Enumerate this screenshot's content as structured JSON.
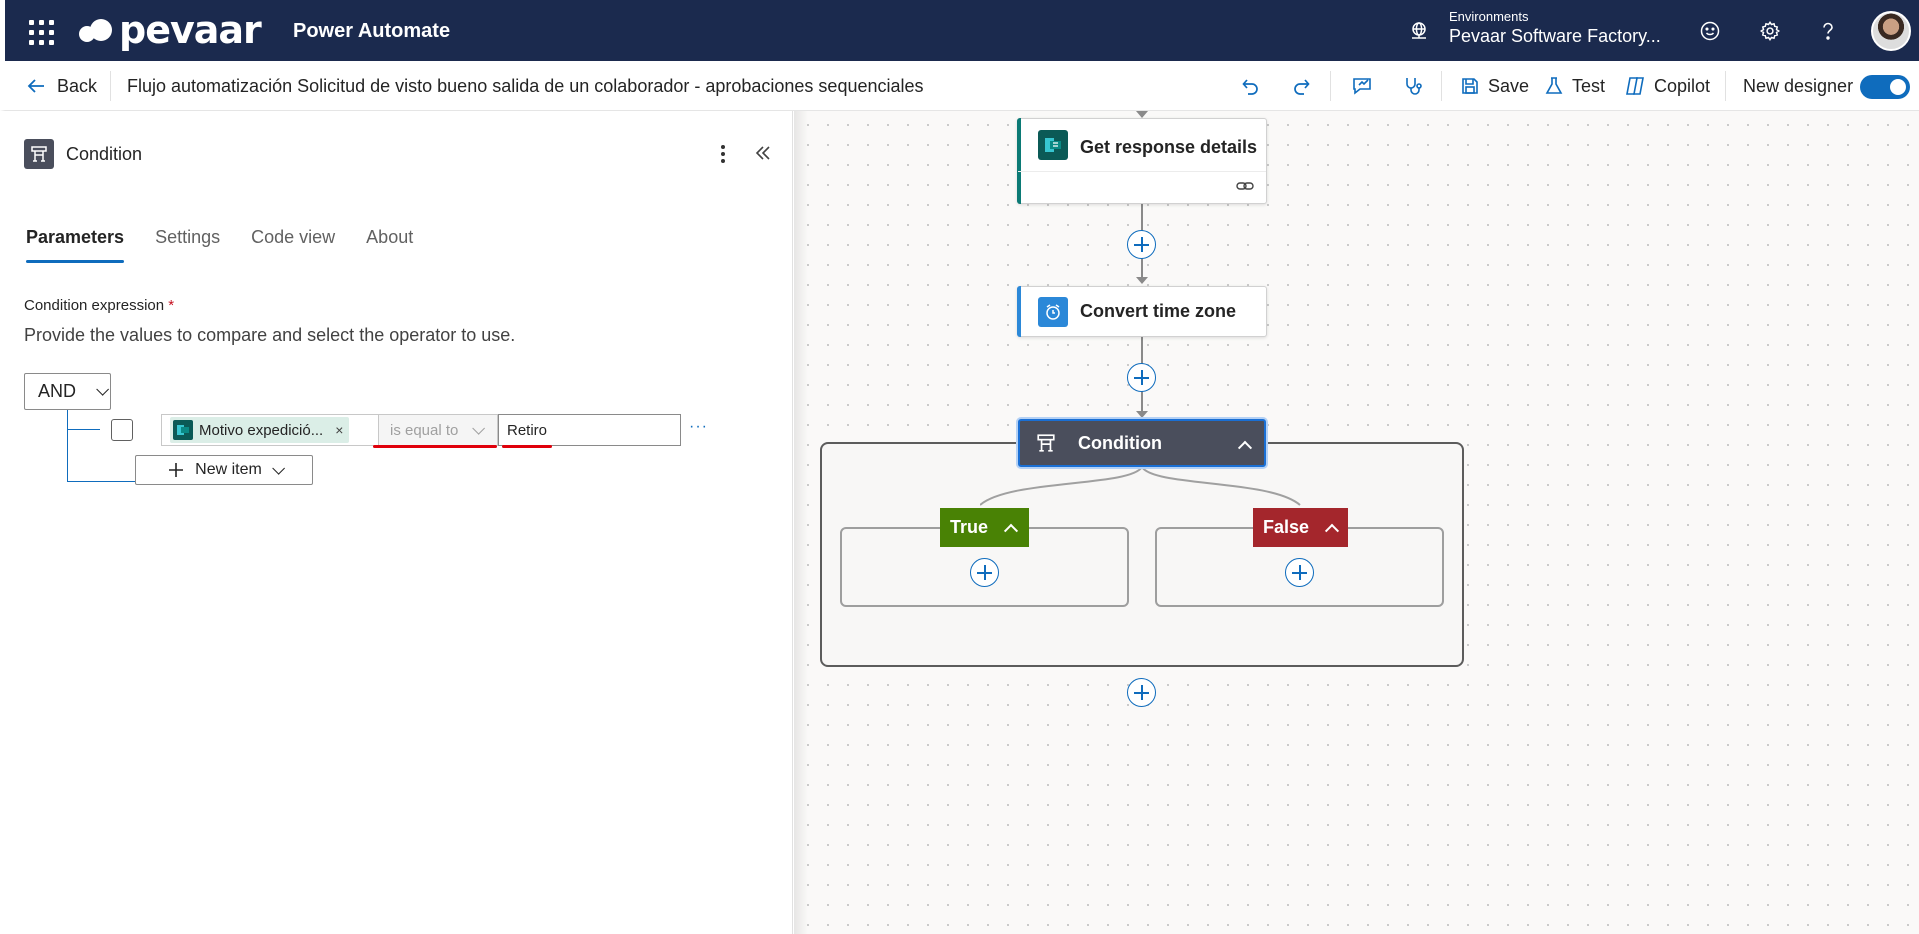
{
  "header": {
    "brand": "pevaar",
    "app_name": "Power Automate",
    "environments_label": "Environments",
    "environment_name": "Pevaar Software Factory..."
  },
  "commandbar": {
    "back_label": "Back",
    "flow_title": "Flujo automatización Solicitud de visto bueno salida de un colaborador - aprobaciones sequenciales",
    "save_label": "Save",
    "test_label": "Test",
    "copilot_label": "Copilot",
    "new_designer_label": "New designer",
    "new_designer_enabled": true
  },
  "panel": {
    "title": "Condition",
    "tabs": [
      {
        "label": "Parameters",
        "active": true
      },
      {
        "label": "Settings",
        "active": false
      },
      {
        "label": "Code view",
        "active": false
      },
      {
        "label": "About",
        "active": false
      }
    ],
    "field_label": "Condition expression",
    "required_mark": "*",
    "field_description": "Provide the values to compare and select the operator to use.",
    "group_operator": "AND",
    "row": {
      "left_token": "Motivo expedició...",
      "token_remove": "×",
      "operator": "is equal to",
      "right_value": "Retiro",
      "more": "···"
    },
    "new_item_label": "New item"
  },
  "canvas": {
    "nodes": [
      {
        "label": "Get response details",
        "accent": "#0b7a75",
        "icon": "forms-icon"
      },
      {
        "label": "Convert time zone",
        "accent": "#2b88d8",
        "icon": "clock-icon"
      }
    ],
    "condition": {
      "label": "Condition",
      "true_label": "True",
      "false_label": "False",
      "true_color": "#498205",
      "false_color": "#a4262c"
    }
  }
}
